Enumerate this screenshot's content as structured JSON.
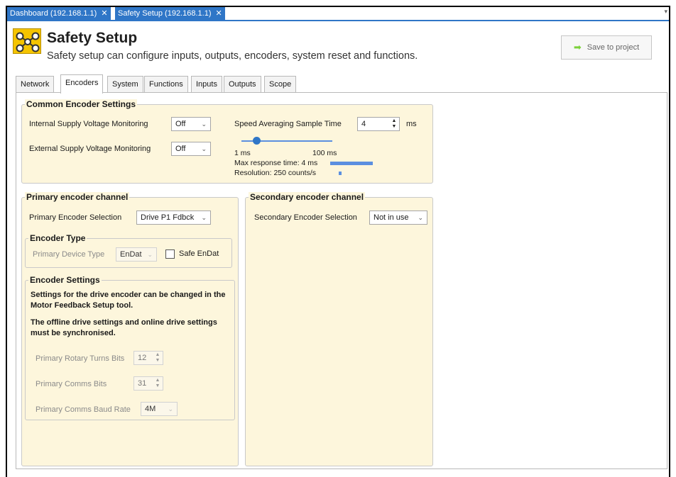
{
  "doc_tabs": [
    {
      "label": "Dashboard (192.168.1.1)",
      "close": "✕"
    },
    {
      "label": "Safety Setup (192.168.1.1)",
      "close": "✕"
    }
  ],
  "tabs_dropdown_icon": "▾",
  "header": {
    "title": "Safety Setup",
    "subtitle": "Safety setup can configure inputs, outputs, encoders, system reset and functions.",
    "save_label": "Save to project",
    "save_icon": "➡"
  },
  "tabs": [
    "Network",
    "Encoders",
    "System",
    "Functions",
    "Inputs",
    "Outputs",
    "Scope"
  ],
  "active_tab": "Encoders",
  "common": {
    "legend": "Common Encoder Settings",
    "internal_label": "Internal Supply Voltage Monitoring",
    "internal_value": "Off",
    "external_label": "External Supply Voltage Monitoring",
    "external_value": "Off",
    "speed_label": "Speed Averaging Sample Time",
    "speed_value": "4",
    "speed_unit": "ms",
    "slider_min": "1 ms",
    "slider_max": "100 ms",
    "slider_level": 0.06,
    "max_response": "Max response time: 4 ms",
    "max_response_level": 0.04,
    "resolution": "Resolution: 250 counts/s",
    "resolution_level": 0.01
  },
  "primary": {
    "legend": "Primary encoder channel",
    "selection_label": "Primary Encoder Selection",
    "selection_value": "Drive P1 Fdbck",
    "type_legend": "Encoder Type",
    "device_type_label": "Primary Device Type",
    "device_type_value": "EnDat",
    "safe_endat_label": "Safe EnDat",
    "settings_legend": "Encoder Settings",
    "note1": "Settings for the drive encoder can be changed in the Motor Feedback Setup tool.",
    "note2": "The offline drive settings and online drive settings must be synchronised.",
    "rotary_label": "Primary Rotary Turns Bits",
    "rotary_value": "12",
    "comms_bits_label": "Primary Comms Bits",
    "comms_bits_value": "31",
    "baud_label": "Primary Comms Baud Rate",
    "baud_value": "4M"
  },
  "secondary": {
    "legend": "Secondary encoder channel",
    "selection_label": "Secondary Encoder Selection",
    "selection_value": "Not in use"
  },
  "colors": {
    "tab_blue": "#2f76c7",
    "panel_bg": "#fdf6dc",
    "icon_yellow": "#f5c400",
    "bar_blue": "#5b8fe0",
    "save_arrow": "#7bd13a"
  }
}
